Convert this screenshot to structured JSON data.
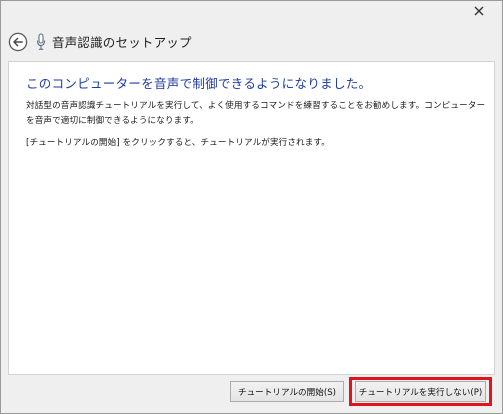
{
  "window": {
    "close_icon": "close-icon"
  },
  "header": {
    "back_icon": "back-arrow-icon",
    "mic_icon": "microphone-icon",
    "title": "音声認識のセットアップ"
  },
  "content": {
    "heading": "このコンピューターを音声で制御できるようになりました。",
    "paragraph1": "対話型の音声認識チュートリアルを実行して、よく使用するコマンドを練習することをお勧めします。コンピューターを音声で適切に制御できるようになります。",
    "paragraph2": "[チュートリアルの開始] をクリックすると、チュートリアルが実行されます。"
  },
  "footer": {
    "start_tutorial_label": "チュートリアルの開始(S)",
    "skip_tutorial_label": "チュートリアルを実行しない(P)",
    "highlight_color": "#e0141e"
  },
  "colors": {
    "heading": "#1f3c9e",
    "window_bg": "#efefef",
    "content_bg": "#ffffff"
  }
}
